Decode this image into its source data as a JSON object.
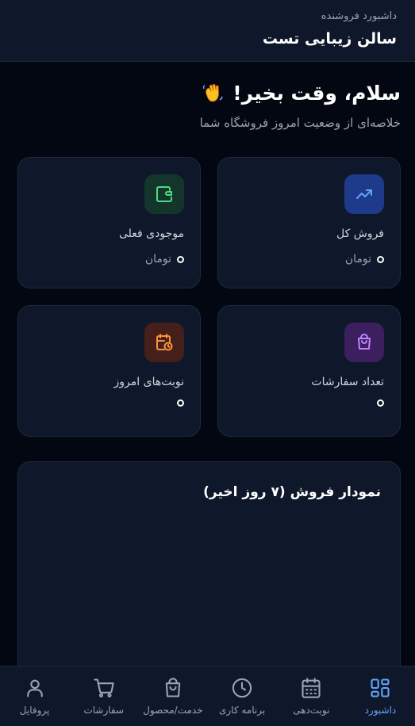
{
  "header": {
    "subtitle": "داشبورد فروشنده",
    "title": "سالن زیبایی تست"
  },
  "greeting": {
    "title": "سلام، وقت بخیر!",
    "subtitle": "خلاصه‌ای از وضعیت امروز فروشگاه شما"
  },
  "cards": {
    "total_sales": {
      "label": "فروش کل",
      "unit": "تومان",
      "icon": "trending-up-icon",
      "color": "#60a5fa"
    },
    "balance": {
      "label": "موجودی فعلی",
      "unit": "تومان",
      "icon": "wallet-icon",
      "color": "#4ade80"
    },
    "orders": {
      "label": "تعداد سفارشات",
      "icon": "shopping-bag-icon",
      "color": "#c084fc"
    },
    "appointments": {
      "label": "نوبت‌های امروز",
      "icon": "calendar-clock-icon",
      "color": "#fb923c"
    }
  },
  "chart": {
    "title": "نمودار فروش (۷ روز اخیر)"
  },
  "nav": {
    "dashboard": "داشبورد",
    "booking": "نوبت‌دهی",
    "schedule": "برنامه کاری",
    "services": "خدمت/محصول",
    "orders": "سفارشات",
    "profile": "پروفایل"
  },
  "colors": {
    "accent": "#60a5fa",
    "background": "#030712",
    "surface": "#0f172a"
  }
}
